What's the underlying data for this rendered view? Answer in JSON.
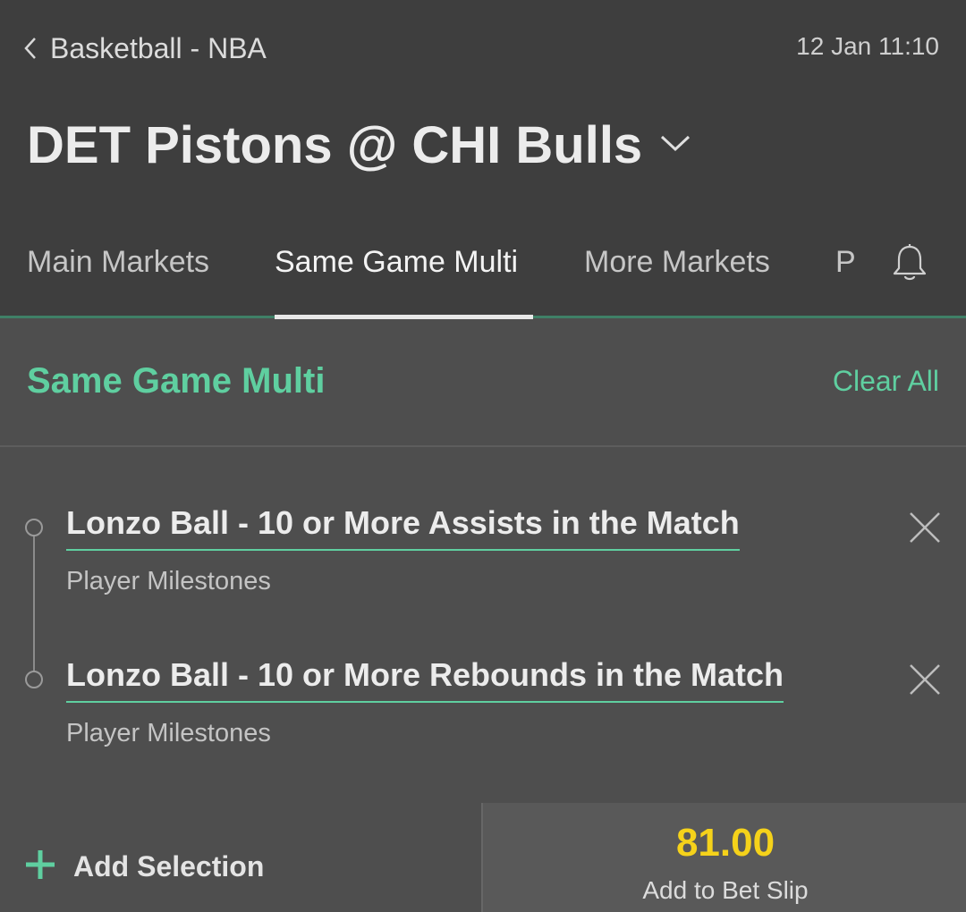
{
  "header": {
    "back_label": "Basketball - NBA",
    "datetime": "12 Jan 11:10",
    "match_title": "DET Pistons @ CHI Bulls"
  },
  "tabs": [
    {
      "label": "Main Markets",
      "active": false
    },
    {
      "label": "Same Game Multi",
      "active": true
    },
    {
      "label": "More Markets",
      "active": false
    },
    {
      "label": "P",
      "active": false
    }
  ],
  "icons": {
    "back": "chevron-left-icon",
    "title_toggle": "chevron-down-icon",
    "notifications": "bell-icon",
    "remove": "close-icon",
    "add": "plus-icon"
  },
  "sgm": {
    "title": "Same Game Multi",
    "clear_all": "Clear All",
    "selections": [
      {
        "title": "Lonzo Ball - 10 or More Assists in the Match",
        "market": "Player Milestones"
      },
      {
        "title": "Lonzo Ball - 10 or More Rebounds in the Match",
        "market": "Player Milestones"
      }
    ]
  },
  "footer": {
    "add_selection": "Add Selection",
    "odds": "81.00",
    "add_to_betslip": "Add to Bet Slip"
  },
  "colors": {
    "header_bg": "#3e3e3e",
    "body_bg": "#4e4e4e",
    "accent_green": "#5fcfa0",
    "odds_yellow": "#f5d21a"
  }
}
